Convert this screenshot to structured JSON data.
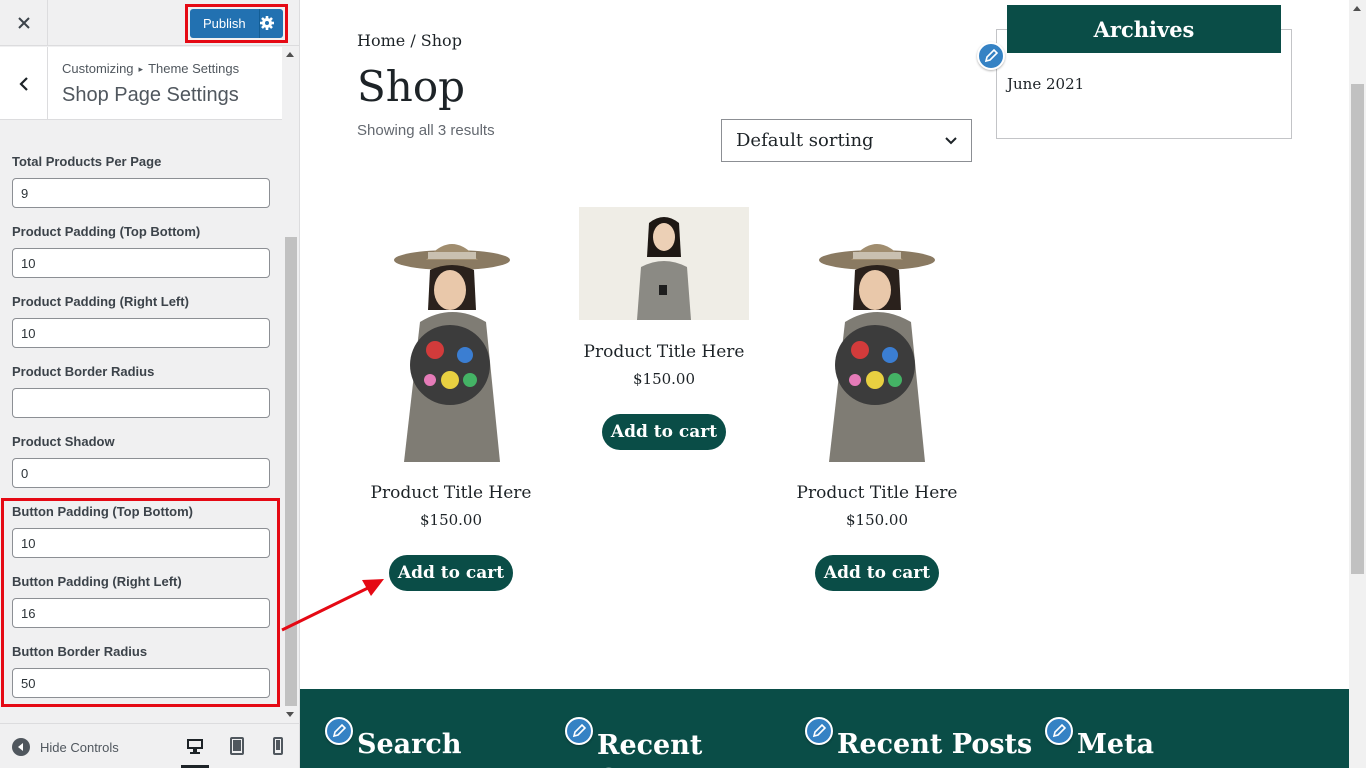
{
  "sidebar": {
    "close_icon": "close-icon",
    "publish_label": "Publish",
    "breadcrumb": {
      "root": "Customizing",
      "section": "Theme Settings"
    },
    "section_title": "Shop Page Settings",
    "fields": [
      {
        "label": "Total Products Per Page",
        "value": "9"
      },
      {
        "label": "Product Padding (Top Bottom)",
        "value": "10"
      },
      {
        "label": "Product Padding (Right Left)",
        "value": "10"
      },
      {
        "label": "Product Border Radius",
        "value": ""
      },
      {
        "label": "Product Shadow",
        "value": "0"
      },
      {
        "label": "Button Padding (Top Bottom)",
        "value": "10"
      },
      {
        "label": "Button Padding (Right Left)",
        "value": "16"
      },
      {
        "label": "Button Border Radius",
        "value": "50"
      }
    ],
    "hide_controls_label": "Hide Controls",
    "accent": "#2271b1",
    "highlight_color": "#e50914"
  },
  "preview": {
    "breadcrumb": "Home / Shop",
    "title": "Shop",
    "result_count": "Showing all 3 results",
    "sorting_selected": "Default sorting",
    "products": [
      {
        "title": "Product Title Here",
        "price": "$150.00",
        "button": "Add to cart"
      },
      {
        "title": "Product Title Here",
        "price": "$150.00",
        "button": "Add to cart"
      },
      {
        "title": "Product Title Here",
        "price": "$150.00",
        "button": "Add to cart"
      }
    ],
    "archives": {
      "title": "Archives",
      "items": [
        "June 2021"
      ]
    },
    "footer_widgets": [
      "Search",
      "Recent C",
      "Recent Posts",
      "Meta"
    ],
    "brand_color": "#0a4d47"
  }
}
